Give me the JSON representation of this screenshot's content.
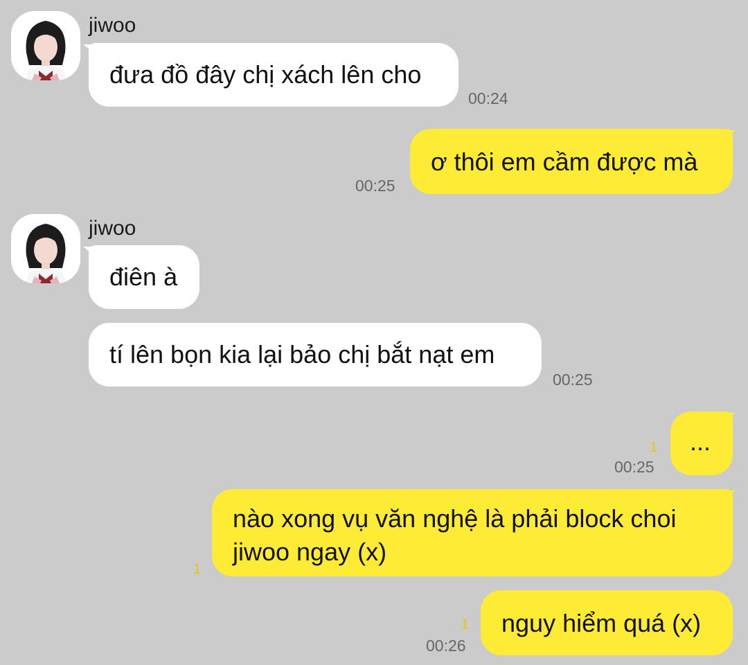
{
  "contact": {
    "name": "jiwoo"
  },
  "messages": [
    {
      "side": "in",
      "sender": "jiwoo",
      "text": "đưa đồ đây chị xách lên cho",
      "time": "00:24"
    },
    {
      "side": "out",
      "text": "ơ thôi em cầm được mà",
      "time": "00:25"
    },
    {
      "side": "in",
      "sender": "jiwoo",
      "text": "điên à"
    },
    {
      "side": "in",
      "text": "tí lên bọn kia lại bảo chị bắt nạt em",
      "time": "00:25"
    },
    {
      "side": "out",
      "text": "...",
      "unread": "1",
      "time": "00:25"
    },
    {
      "side": "out",
      "text_line1": "nào xong vụ văn nghệ là phải block choi",
      "text_line2": "jiwoo ngay (x)",
      "unread": "1"
    },
    {
      "side": "out",
      "text": "nguy hiểm quá (x)",
      "unread": "1",
      "time": "00:26"
    }
  ],
  "colors": {
    "background": "#cbcbcb",
    "incoming_bubble": "#ffffff",
    "outgoing_bubble": "#fdeb36",
    "unread_count": "#e8c800"
  },
  "icons": {
    "avatar": "avatar-icon"
  }
}
